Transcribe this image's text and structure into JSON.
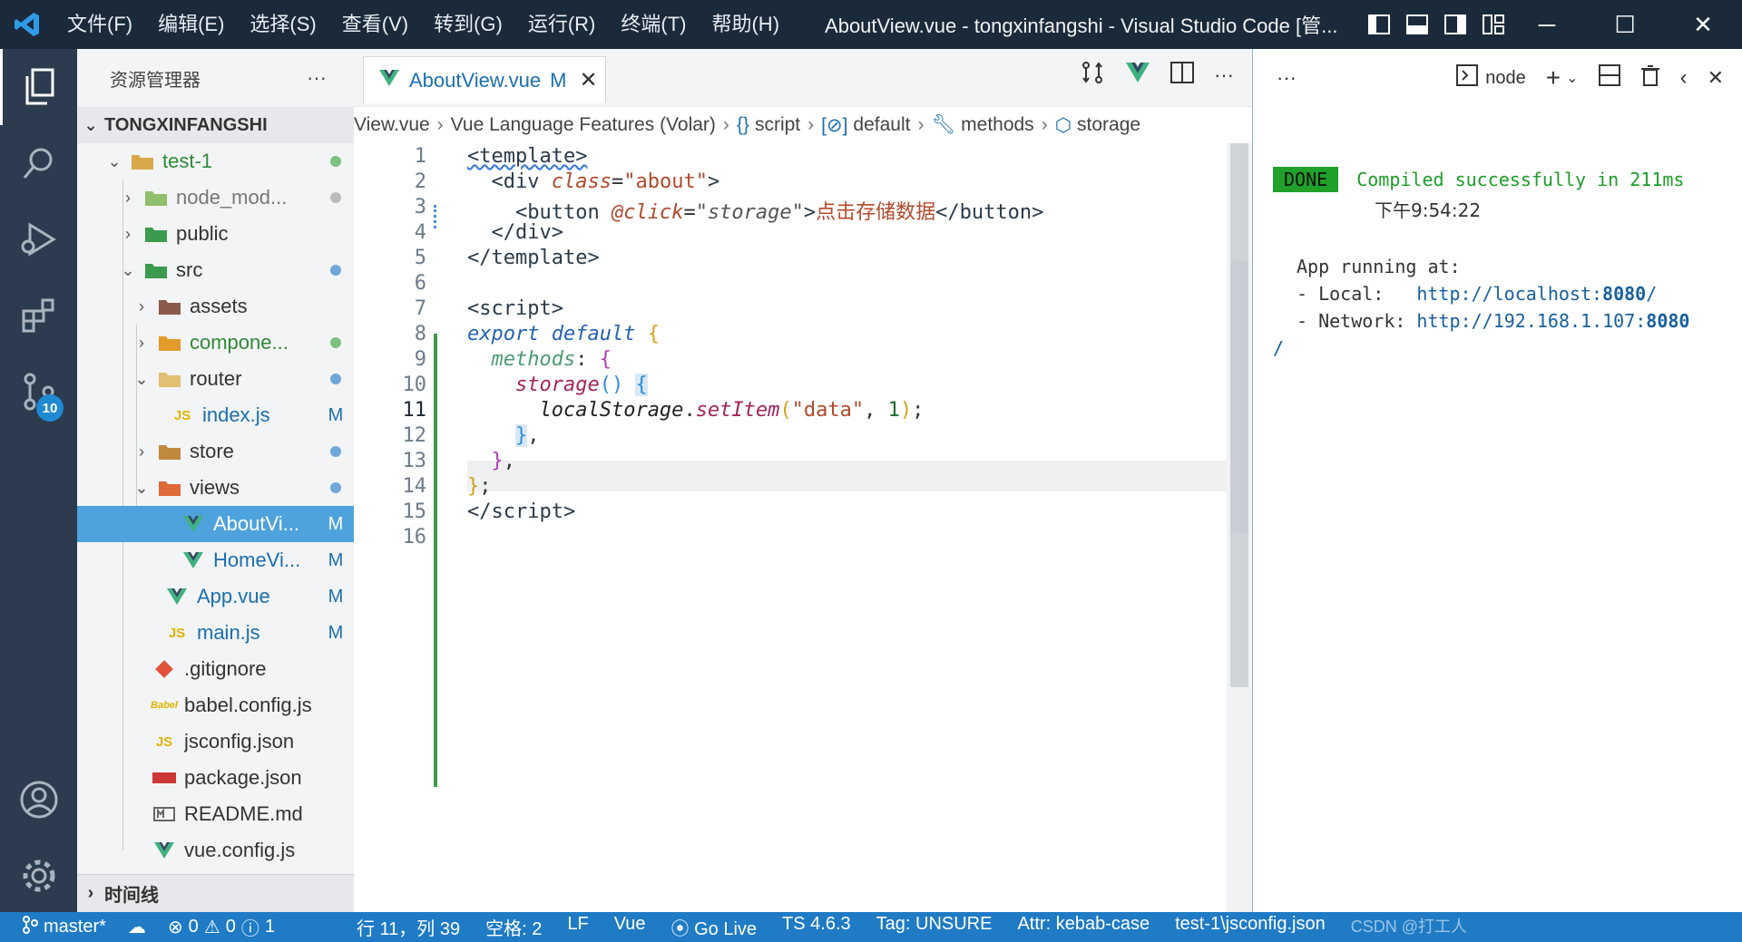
{
  "titlebar": {
    "menus": [
      "文件(F)",
      "编辑(E)",
      "选择(S)",
      "查看(V)",
      "转到(G)",
      "运行(R)",
      "终端(T)",
      "帮助(H)"
    ],
    "window_title": "AboutView.vue - tongxinfangshi - Visual Studio Code [管..."
  },
  "activity": {
    "scm_badge": "10"
  },
  "sidebar": {
    "header": "资源管理器",
    "more": "···",
    "section": "TONGXINFANGSHI",
    "items": [
      {
        "label": "test-1",
        "status": "dot-green"
      },
      {
        "label": "node_mod...",
        "status": "dot-gray"
      },
      {
        "label": "public",
        "status": ""
      },
      {
        "label": "src",
        "status": "dot-blue"
      },
      {
        "label": "assets",
        "status": ""
      },
      {
        "label": "compone...",
        "status": "dot-green"
      },
      {
        "label": "router",
        "status": "dot-blue"
      },
      {
        "label": "index.js",
        "status": "M"
      },
      {
        "label": "store",
        "status": "dot-blue"
      },
      {
        "label": "views",
        "status": "dot-blue"
      },
      {
        "label": "AboutVi...",
        "status": "M"
      },
      {
        "label": "HomeVi...",
        "status": "M"
      },
      {
        "label": "App.vue",
        "status": "M"
      },
      {
        "label": "main.js",
        "status": "M"
      },
      {
        "label": ".gitignore",
        "status": ""
      },
      {
        "label": "babel.config.js",
        "status": ""
      },
      {
        "label": "jsconfig.json",
        "status": ""
      },
      {
        "label": "package.json",
        "status": ""
      },
      {
        "label": "README.md",
        "status": ""
      },
      {
        "label": "vue.config.js",
        "status": ""
      }
    ],
    "timeline": "时间线"
  },
  "editor": {
    "tab": {
      "label": "AboutView.vue",
      "mod": "M",
      "close": "✕"
    },
    "breadcrumb": [
      "View.vue",
      "Vue Language Features (Volar)",
      "script",
      "default",
      "methods",
      "storage"
    ],
    "line_numbers": [
      "1",
      "2",
      "3",
      "4",
      "5",
      "6",
      "7",
      "8",
      "9",
      "10",
      "11",
      "12",
      "13",
      "14",
      "15",
      "16"
    ]
  },
  "panel": {
    "more": "···",
    "terminal_name": "node",
    "done": "DONE",
    "compiled": "Compiled successfully in 211ms",
    "time": "下午9:54:22",
    "running": "App running at:",
    "local_label": "- Local:",
    "local_url": "http://localhost:",
    "local_port": "8080",
    "local_tail": "/",
    "network_label": "- Network:",
    "network_url": "http://192.168.1.107:",
    "network_port": "8080",
    "network_tail": "/"
  },
  "status": {
    "branch": "master*",
    "errors": "0",
    "warnings": "0",
    "infos": "1",
    "position": "行 11，列 39",
    "spaces": "空格: 2",
    "eol": "LF",
    "language": "Vue",
    "golive": "Go Live",
    "ts": "TS 4.6.3",
    "tag": "Tag: UNSURE",
    "attr": "Attr: kebab-case",
    "config": "test-1\\jsconfig.json",
    "watermark": "CSDN @打工人"
  },
  "colors": {
    "titlebar": "#1b2a3a",
    "activity": "#2c3b4e",
    "statusbar": "#1f7bc5",
    "selection": "#4ea3dd",
    "done_bg": "#1fa12a"
  }
}
